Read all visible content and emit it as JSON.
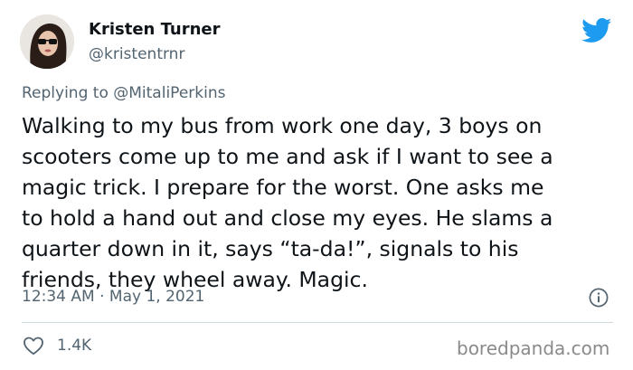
{
  "author": {
    "name": "Kristen Turner",
    "handle": "@kristentrnr"
  },
  "reply": {
    "prefix": "Replying to",
    "mention": "@MitaliPerkins"
  },
  "tweet": {
    "lines": [
      "Walking to my bus from work one day, 3 boys on",
      "scooters come up to me and ask if I want to see a",
      "magic trick. I prepare for the worst. One asks me",
      "to hold a hand out and close my eyes. He slams a",
      "quarter down in it, says “ta-da!”, signals to his",
      "friends, they wheel away. Magic."
    ]
  },
  "meta": {
    "timestamp": "12:34 AM · May 1, 2021"
  },
  "actions": {
    "like_count": "1.4K"
  },
  "watermark": "boredpanda.com",
  "icons": {
    "logo": "twitter-bird-icon",
    "info": "info-icon",
    "like": "heart-icon"
  },
  "colors": {
    "brand": "#1d9bf0",
    "text": "#0f1419",
    "secondary": "#536471",
    "divider": "#cfd9de"
  }
}
